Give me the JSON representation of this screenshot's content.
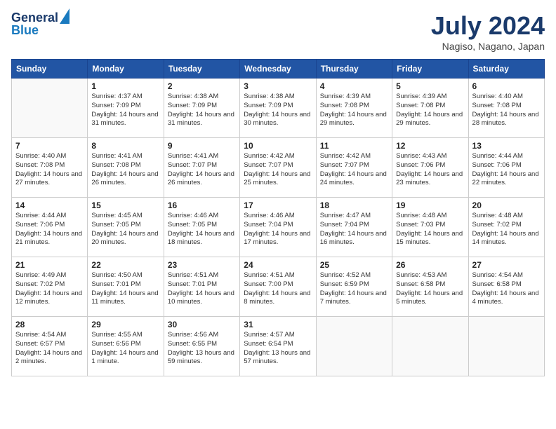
{
  "logo": {
    "general": "General",
    "blue": "Blue"
  },
  "header": {
    "month_year": "July 2024",
    "location": "Nagiso, Nagano, Japan"
  },
  "weekdays": [
    "Sunday",
    "Monday",
    "Tuesday",
    "Wednesday",
    "Thursday",
    "Friday",
    "Saturday"
  ],
  "weeks": [
    [
      {
        "day": "",
        "sunrise": "",
        "sunset": "",
        "daylight": ""
      },
      {
        "day": "1",
        "sunrise": "Sunrise: 4:37 AM",
        "sunset": "Sunset: 7:09 PM",
        "daylight": "Daylight: 14 hours and 31 minutes."
      },
      {
        "day": "2",
        "sunrise": "Sunrise: 4:38 AM",
        "sunset": "Sunset: 7:09 PM",
        "daylight": "Daylight: 14 hours and 31 minutes."
      },
      {
        "day": "3",
        "sunrise": "Sunrise: 4:38 AM",
        "sunset": "Sunset: 7:09 PM",
        "daylight": "Daylight: 14 hours and 30 minutes."
      },
      {
        "day": "4",
        "sunrise": "Sunrise: 4:39 AM",
        "sunset": "Sunset: 7:08 PM",
        "daylight": "Daylight: 14 hours and 29 minutes."
      },
      {
        "day": "5",
        "sunrise": "Sunrise: 4:39 AM",
        "sunset": "Sunset: 7:08 PM",
        "daylight": "Daylight: 14 hours and 29 minutes."
      },
      {
        "day": "6",
        "sunrise": "Sunrise: 4:40 AM",
        "sunset": "Sunset: 7:08 PM",
        "daylight": "Daylight: 14 hours and 28 minutes."
      }
    ],
    [
      {
        "day": "7",
        "sunrise": "Sunrise: 4:40 AM",
        "sunset": "Sunset: 7:08 PM",
        "daylight": "Daylight: 14 hours and 27 minutes."
      },
      {
        "day": "8",
        "sunrise": "Sunrise: 4:41 AM",
        "sunset": "Sunset: 7:08 PM",
        "daylight": "Daylight: 14 hours and 26 minutes."
      },
      {
        "day": "9",
        "sunrise": "Sunrise: 4:41 AM",
        "sunset": "Sunset: 7:07 PM",
        "daylight": "Daylight: 14 hours and 26 minutes."
      },
      {
        "day": "10",
        "sunrise": "Sunrise: 4:42 AM",
        "sunset": "Sunset: 7:07 PM",
        "daylight": "Daylight: 14 hours and 25 minutes."
      },
      {
        "day": "11",
        "sunrise": "Sunrise: 4:42 AM",
        "sunset": "Sunset: 7:07 PM",
        "daylight": "Daylight: 14 hours and 24 minutes."
      },
      {
        "day": "12",
        "sunrise": "Sunrise: 4:43 AM",
        "sunset": "Sunset: 7:06 PM",
        "daylight": "Daylight: 14 hours and 23 minutes."
      },
      {
        "day": "13",
        "sunrise": "Sunrise: 4:44 AM",
        "sunset": "Sunset: 7:06 PM",
        "daylight": "Daylight: 14 hours and 22 minutes."
      }
    ],
    [
      {
        "day": "14",
        "sunrise": "Sunrise: 4:44 AM",
        "sunset": "Sunset: 7:06 PM",
        "daylight": "Daylight: 14 hours and 21 minutes."
      },
      {
        "day": "15",
        "sunrise": "Sunrise: 4:45 AM",
        "sunset": "Sunset: 7:05 PM",
        "daylight": "Daylight: 14 hours and 20 minutes."
      },
      {
        "day": "16",
        "sunrise": "Sunrise: 4:46 AM",
        "sunset": "Sunset: 7:05 PM",
        "daylight": "Daylight: 14 hours and 18 minutes."
      },
      {
        "day": "17",
        "sunrise": "Sunrise: 4:46 AM",
        "sunset": "Sunset: 7:04 PM",
        "daylight": "Daylight: 14 hours and 17 minutes."
      },
      {
        "day": "18",
        "sunrise": "Sunrise: 4:47 AM",
        "sunset": "Sunset: 7:04 PM",
        "daylight": "Daylight: 14 hours and 16 minutes."
      },
      {
        "day": "19",
        "sunrise": "Sunrise: 4:48 AM",
        "sunset": "Sunset: 7:03 PM",
        "daylight": "Daylight: 14 hours and 15 minutes."
      },
      {
        "day": "20",
        "sunrise": "Sunrise: 4:48 AM",
        "sunset": "Sunset: 7:02 PM",
        "daylight": "Daylight: 14 hours and 14 minutes."
      }
    ],
    [
      {
        "day": "21",
        "sunrise": "Sunrise: 4:49 AM",
        "sunset": "Sunset: 7:02 PM",
        "daylight": "Daylight: 14 hours and 12 minutes."
      },
      {
        "day": "22",
        "sunrise": "Sunrise: 4:50 AM",
        "sunset": "Sunset: 7:01 PM",
        "daylight": "Daylight: 14 hours and 11 minutes."
      },
      {
        "day": "23",
        "sunrise": "Sunrise: 4:51 AM",
        "sunset": "Sunset: 7:01 PM",
        "daylight": "Daylight: 14 hours and 10 minutes."
      },
      {
        "day": "24",
        "sunrise": "Sunrise: 4:51 AM",
        "sunset": "Sunset: 7:00 PM",
        "daylight": "Daylight: 14 hours and 8 minutes."
      },
      {
        "day": "25",
        "sunrise": "Sunrise: 4:52 AM",
        "sunset": "Sunset: 6:59 PM",
        "daylight": "Daylight: 14 hours and 7 minutes."
      },
      {
        "day": "26",
        "sunrise": "Sunrise: 4:53 AM",
        "sunset": "Sunset: 6:58 PM",
        "daylight": "Daylight: 14 hours and 5 minutes."
      },
      {
        "day": "27",
        "sunrise": "Sunrise: 4:54 AM",
        "sunset": "Sunset: 6:58 PM",
        "daylight": "Daylight: 14 hours and 4 minutes."
      }
    ],
    [
      {
        "day": "28",
        "sunrise": "Sunrise: 4:54 AM",
        "sunset": "Sunset: 6:57 PM",
        "daylight": "Daylight: 14 hours and 2 minutes."
      },
      {
        "day": "29",
        "sunrise": "Sunrise: 4:55 AM",
        "sunset": "Sunset: 6:56 PM",
        "daylight": "Daylight: 14 hours and 1 minute."
      },
      {
        "day": "30",
        "sunrise": "Sunrise: 4:56 AM",
        "sunset": "Sunset: 6:55 PM",
        "daylight": "Daylight: 13 hours and 59 minutes."
      },
      {
        "day": "31",
        "sunrise": "Sunrise: 4:57 AM",
        "sunset": "Sunset: 6:54 PM",
        "daylight": "Daylight: 13 hours and 57 minutes."
      },
      {
        "day": "",
        "sunrise": "",
        "sunset": "",
        "daylight": ""
      },
      {
        "day": "",
        "sunrise": "",
        "sunset": "",
        "daylight": ""
      },
      {
        "day": "",
        "sunrise": "",
        "sunset": "",
        "daylight": ""
      }
    ]
  ]
}
